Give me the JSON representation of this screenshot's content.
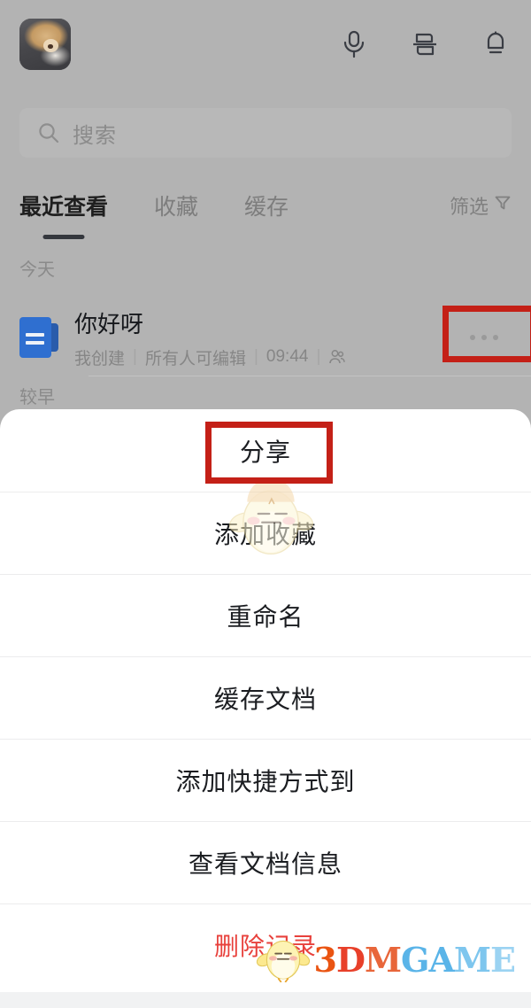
{
  "topbar": {
    "avatar_alt": "用户头像",
    "actions": [
      {
        "name": "microphone-icon",
        "label": "语音"
      },
      {
        "name": "scan-icon",
        "label": "扫一扫"
      },
      {
        "name": "bell-icon",
        "label": "通知"
      }
    ]
  },
  "search": {
    "placeholder": "搜索",
    "value": ""
  },
  "tabs": [
    {
      "label": "最近查看",
      "active": true
    },
    {
      "label": "收藏",
      "active": false
    },
    {
      "label": "缓存",
      "active": false
    }
  ],
  "filter": {
    "label": "筛选"
  },
  "sections": {
    "today": "今天",
    "earlier": "较早"
  },
  "document": {
    "title": "你好呀",
    "owner": "我创建",
    "permission": "所有人可编辑",
    "time": "09:44",
    "separator": "|",
    "more_label": "更多操作"
  },
  "action_sheet": {
    "items": [
      {
        "label": "分享",
        "danger": false,
        "highlighted": true
      },
      {
        "label": "添加收藏",
        "danger": false,
        "highlighted": false
      },
      {
        "label": "重命名",
        "danger": false,
        "highlighted": false
      },
      {
        "label": "缓存文档",
        "danger": false,
        "highlighted": false
      },
      {
        "label": "添加快捷方式到",
        "danger": false,
        "highlighted": false
      },
      {
        "label": "查看文档信息",
        "danger": false,
        "highlighted": false
      },
      {
        "label": "删除记录",
        "danger": true,
        "highlighted": false
      }
    ]
  },
  "watermark": {
    "brand_part1": "3",
    "brand_part2": "D",
    "brand_part3": "M",
    "brand_part4": "G",
    "brand_part5": "A",
    "brand_part6": "M",
    "brand_part7": "E",
    "full_text": "3DMGAME"
  },
  "colors": {
    "highlight_red": "#c42017",
    "danger_red": "#e8413c",
    "doc_blue": "#2f6fd0",
    "overlay_gray": "#b3b3b3",
    "sheet_white": "#ffffff",
    "tab_active": "#1f1f1f"
  }
}
